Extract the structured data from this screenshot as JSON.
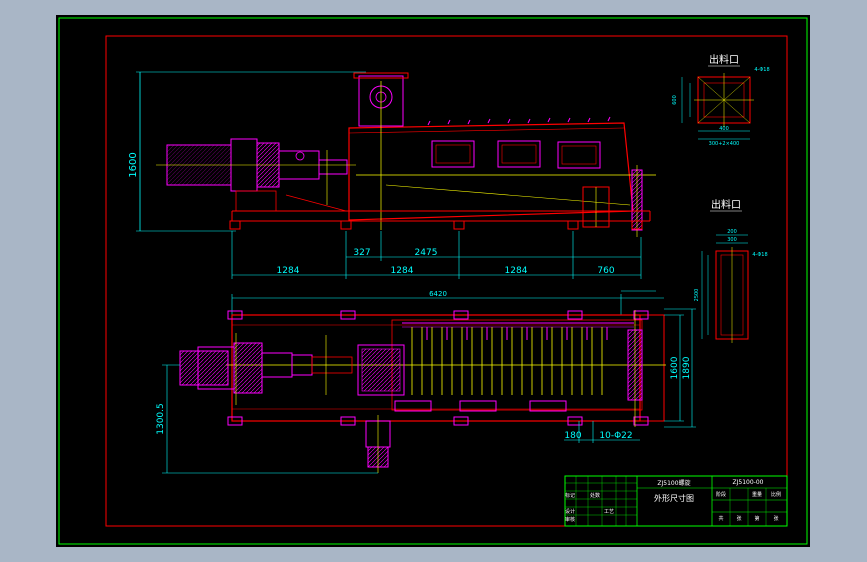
{
  "colors": {
    "background": "#000000",
    "outer_border": "#00ff00",
    "frame": "#ff0000",
    "dimension": "#00ffff",
    "body": "#ff0000",
    "equipment": "#ff00ff",
    "centerline": "#ffff00",
    "text": "#00ffff",
    "title_block_grid": "#00ff00"
  },
  "views": {
    "front": {
      "height_dim": "1600",
      "segment_dims": [
        "327",
        "2475"
      ],
      "bottom_dims": [
        "1284",
        "1284",
        "1284",
        "760"
      ]
    },
    "plan": {
      "overall_dim": "6420",
      "width_dims": [
        "1600",
        "1890"
      ],
      "side_dim": "1300.5",
      "bottom_dims": [
        "180",
        "10-Φ22"
      ]
    },
    "outlet_top": {
      "label": "出料口",
      "dim_side": "4-Φ18",
      "dim_left": "600",
      "dim_bottom": "400",
      "dim_bottom2": "300+2×400"
    },
    "outlet_side": {
      "label": "出料口",
      "dim_top1": "200",
      "dim_top2": "300",
      "dim_left": "2500",
      "dim_right": "4-Φ18"
    }
  },
  "title_block": {
    "drawing_no": "ZJ5100-00",
    "product_name": "ZJ5100螺旋",
    "title": "外形尺寸图",
    "row_labels": [
      "标记",
      "处数",
      "设计",
      "审核",
      "工艺"
    ],
    "col_labels": [
      "阶段",
      "重量",
      "比例"
    ],
    "sheet_labels": [
      "共",
      "张",
      "第",
      "张"
    ]
  }
}
